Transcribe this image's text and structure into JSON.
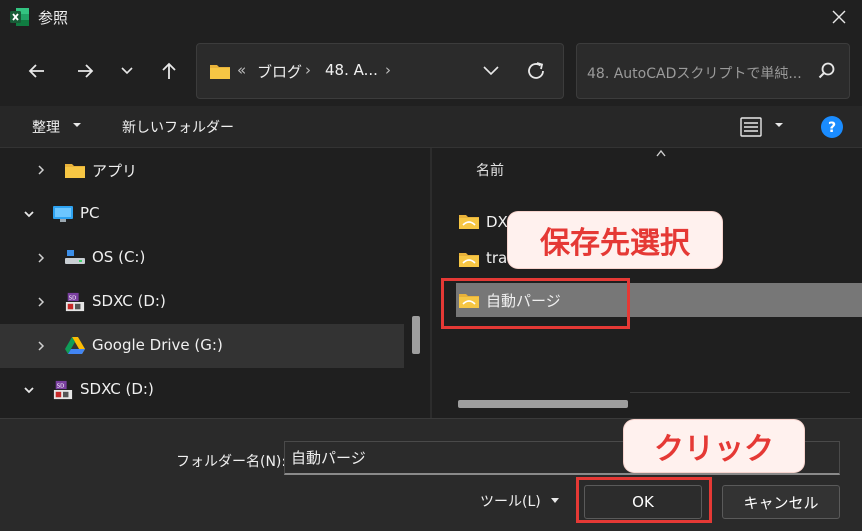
{
  "window": {
    "title": "参照",
    "colors": {
      "background": "#1f1f1f",
      "annotation": "#e53935"
    }
  },
  "nav": {
    "back_icon": "arrow-left-icon",
    "forward_icon": "arrow-right-icon",
    "recent_icon": "chevron-down-icon",
    "up_icon": "arrow-up-icon",
    "address": {
      "overflow": "«",
      "segments": [
        "ブログ",
        "48. A..."
      ],
      "separator": "›"
    },
    "search_placeholder": "48. AutoCADスクリプトで単純..."
  },
  "toolbar": {
    "organize_label": "整理",
    "new_folder_label": "新しいフォルダー"
  },
  "sidebar": {
    "items": [
      {
        "label": "アプリ",
        "icon": "folder-icon",
        "expanded": false
      },
      {
        "label": "PC",
        "icon": "pc-icon",
        "expanded": true
      },
      {
        "label": "OS (C:)",
        "icon": "drive-icon",
        "expanded": false
      },
      {
        "label": "SDXC (D:)",
        "icon": "sd-card-icon",
        "expanded": false
      },
      {
        "label": "Google Drive (G:)",
        "icon": "google-drive-icon",
        "expanded": false,
        "selected": true
      },
      {
        "label": "SDXC (D:)",
        "icon": "sd-card-icon",
        "expanded": true
      }
    ]
  },
  "file_list": {
    "column_name": "名前",
    "items": [
      {
        "label": "DXF変換"
      },
      {
        "label": "tra"
      },
      {
        "label": "自動パージ",
        "selected": true
      }
    ]
  },
  "footer": {
    "folder_name_label": "フォルダー名(N):",
    "folder_name_value": "自動パージ",
    "tools_label": "ツール(L)",
    "ok_label": "OK",
    "cancel_label": "キャンセル"
  },
  "annotations": {
    "select_destination": "保存先選択",
    "click": "クリック"
  }
}
